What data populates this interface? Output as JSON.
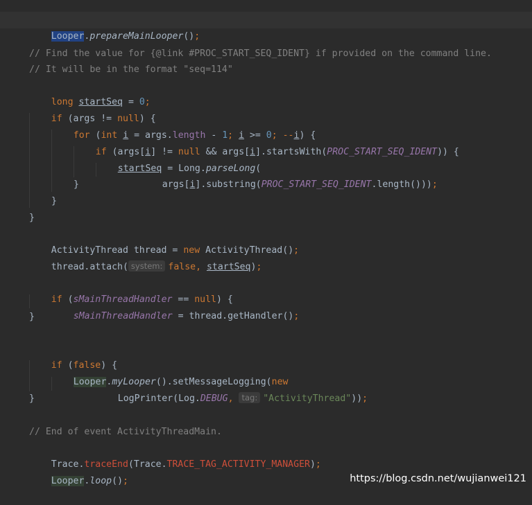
{
  "lines": {
    "l1": {
      "a": "Looper",
      "b": ".",
      "c": "prepareMainLooper",
      "d": "()",
      "e": ";"
    },
    "l2": {
      "text": "// Find the value for {@link #PROC_START_SEQ_IDENT} if provided on the command line."
    },
    "l3": {
      "text": "// It will be in the format \"seq=114\""
    },
    "l4": {
      "a": "long",
      "b": " ",
      "c": "startSeq",
      "d": " = ",
      "e": "0",
      "f": ";"
    },
    "l5": {
      "a": "if",
      "b": " (args != ",
      "c": "null",
      "d": ") {"
    },
    "l6": {
      "a": "for",
      "b": " (",
      "c": "int",
      "d": " ",
      "e": "i",
      "f": " = args.",
      "g": "length",
      "h": " - ",
      "i": "1",
      "j": "; ",
      "k": "i",
      "l": " >= ",
      "m": "0",
      "n": "; --",
      "o": "i",
      "p": ") {"
    },
    "l7": {
      "a": "if",
      "b": " (args[",
      "c": "i",
      "d": "] != ",
      "e": "null",
      "f": " && args[",
      "g": "i",
      "h": "].startsWith(",
      "i": "PROC_START_SEQ_IDENT",
      "j": ")) {"
    },
    "l8": {
      "a": "startSeq",
      "b": " = Long.",
      "c": "parseLong",
      "d": "("
    },
    "l9": {
      "a": "args[",
      "b": "i",
      "c": "].substring(",
      "d": "PROC_START_SEQ_IDENT",
      "e": ".length())",
      "f": ")",
      "g": ";"
    },
    "l10": {
      "text": "}"
    },
    "l11": {
      "text": "}"
    },
    "l12": {
      "text": "}"
    },
    "l13": {
      "a": "ActivityThread thread = ",
      "b": "new",
      "c": " ActivityThread()",
      "d": ";"
    },
    "l14": {
      "a": "thread.attach(",
      "hint": "system:",
      "b": "false",
      "c": ", ",
      "d": "startSeq",
      "e": ")",
      "f": ";"
    },
    "l15": {
      "a": "if",
      "b": " (",
      "c": "sMainThreadHandler",
      "d": " == ",
      "e": "null",
      "f": ") {"
    },
    "l16": {
      "a": "sMainThreadHandler",
      "b": " = thread.getHandler()",
      "c": ";"
    },
    "l17": {
      "text": "}"
    },
    "l18": {
      "a": "if",
      "b": " (",
      "c": "false",
      "d": ") {"
    },
    "l19": {
      "a": "Looper",
      "b": ".",
      "c": "myLooper",
      "d": "().setMessageLogging(",
      "e": "new"
    },
    "l20": {
      "a": "LogPrinter(Log.",
      "b": "DEBUG",
      "c": ",",
      "hint": "tag:",
      "d": "\"ActivityThread\"",
      "e": "))",
      "f": ";"
    },
    "l21": {
      "text": "}"
    },
    "l22": {
      "text": "// End of event ActivityThreadMain."
    },
    "l23": {
      "a": "Trace.",
      "b": "traceEnd",
      "c": "(Trace.",
      "d": "TRACE_TAG_ACTIVITY_MANAGER",
      "e": ")",
      "f": ";"
    },
    "l24": {
      "a": "Looper",
      "b": ".",
      "c": "loop",
      "d": "()",
      "e": ";"
    }
  },
  "watermark": "https://blog.csdn.net/wujianwei121",
  "colors": {
    "background": "#2b2b2b",
    "keyword": "#cc7832",
    "comment": "#808080",
    "string": "#6a8759",
    "number": "#6897bb",
    "field": "#9876aa"
  }
}
